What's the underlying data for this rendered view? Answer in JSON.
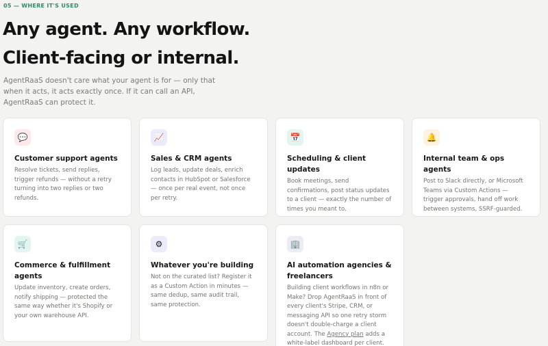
{
  "section": {
    "eyebrow": "05 — WHERE IT'S USED",
    "headline": "Any agent. Any workflow. Client-facing or internal.",
    "subtitle": "AgentRaaS doesn't care what your agent is for — only that when it acts, it acts exactly once. If it can call an API, AgentRaaS can protect it."
  },
  "cards": [
    {
      "icon": "speech-bubble-icon",
      "glyph": "💬",
      "icon_bg": "#fde8ea",
      "title": "Customer support agents",
      "body": "Resolve tickets, send replies, trigger refunds — without a retry turning into two replies or two refunds."
    },
    {
      "icon": "trending-chart-icon",
      "glyph": "📈",
      "icon_bg": "#ecebfb",
      "title": "Sales & CRM agents",
      "body": "Log leads, update deals, enrich contacts in HubSpot or Salesforce — once per real event, not once per retry."
    },
    {
      "icon": "calendar-icon",
      "glyph": "📅",
      "icon_bg": "#e2f5ee",
      "title": "Scheduling & client updates",
      "body": "Book meetings, send confirmations, post status updates to a client — exactly the number of times you meant to."
    },
    {
      "icon": "bell-icon",
      "glyph": "🔔",
      "icon_bg": "#fdf3e0",
      "title": "Internal team & ops agents",
      "body": "Post to Slack directly, or Microsoft Teams via Custom Actions — trigger approvals, hand off work between systems, SSRF-guarded."
    },
    {
      "icon": "shopping-cart-icon",
      "glyph": "🛒",
      "icon_bg": "#e2f5ee",
      "title": "Commerce & fulfillment agents",
      "body": "Update inventory, create orders, notify shipping — protected the same way whether it's Shopify or your own warehouse API."
    },
    {
      "icon": "gear-icon",
      "glyph": "⚙",
      "icon_bg": "#ecebfb",
      "title": "Whatever you're building",
      "body": "Not on the curated list? Register it as a Custom Action in minutes — same dedup, same audit trail, same protection."
    },
    {
      "icon": "office-building-icon",
      "glyph": "🏢",
      "icon_bg": "#ececf4",
      "title": "AI automation agencies & freelancers",
      "body_before": "Building client workflows in n8n or Make? Drop AgentRaaS in front of every client's Stripe, CRM, or messaging API so one retry storm doesn't double-charge a client account. The ",
      "link": "Agency plan",
      "body_after": " adds a white-label dashboard per client."
    }
  ]
}
